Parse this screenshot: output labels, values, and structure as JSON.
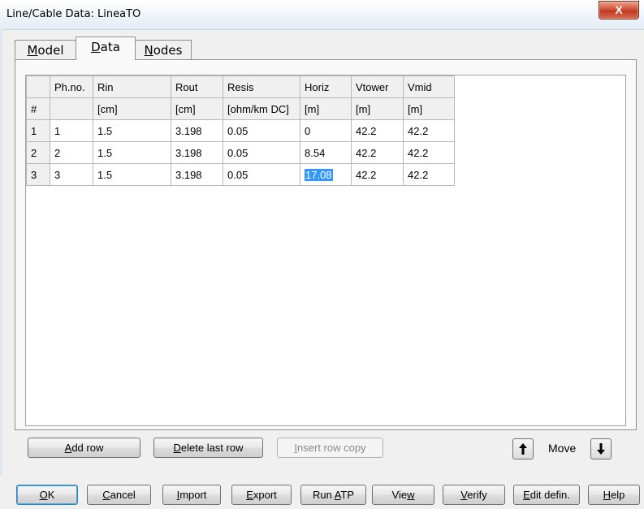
{
  "window": {
    "title": "Line/Cable Data: LineaTO",
    "close_glyph": "X"
  },
  "tabs": [
    {
      "label": "Model",
      "accel": "M",
      "rest": "odel",
      "active": false
    },
    {
      "label": "Data",
      "accel": "D",
      "rest": "ata",
      "active": true
    },
    {
      "label": "Nodes",
      "accel": "N",
      "rest": "odes",
      "active": false
    }
  ],
  "grid": {
    "header1": [
      "",
      "Ph.no.",
      "Rin",
      "Rout",
      "Resis",
      "Horiz",
      "Vtower",
      "Vmid"
    ],
    "header2": [
      "#",
      "",
      "[cm]",
      "[cm]",
      "[ohm/km DC]",
      "[m]",
      "[m]",
      "[m]"
    ],
    "rows": [
      [
        "1",
        "1",
        "1.5",
        "3.198",
        "0.05",
        "0",
        "42.2",
        "42.2"
      ],
      [
        "2",
        "2",
        "1.5",
        "3.198",
        "0.05",
        "8.54",
        "42.2",
        "42.2"
      ],
      [
        "3",
        "3",
        "1.5",
        "3.198",
        "0.05",
        "17.08",
        "42.2",
        "42.2"
      ]
    ],
    "selected_cell": {
      "row": 3,
      "column": "Horiz",
      "value": "17.08"
    }
  },
  "row_buttons": {
    "add": {
      "accel": "A",
      "rest": "dd row"
    },
    "delete": {
      "accel": "D",
      "rest": "elete last row"
    },
    "insert": {
      "accel": "I",
      "rest": "nsert row copy",
      "enabled": false
    }
  },
  "move": {
    "label": "Move",
    "up_icon": "arrow-up-icon",
    "down_icon": "arrow-down-icon"
  },
  "bottom_buttons": {
    "ok": {
      "accel": "O",
      "rest": "K"
    },
    "cancel": {
      "accel": "C",
      "rest": "ancel"
    },
    "import": {
      "accel": "I",
      "rest": "mport"
    },
    "export": {
      "accel": "E",
      "rest": "xport"
    },
    "run_atp": {
      "pre": "Run ",
      "accel": "A",
      "rest": "TP"
    },
    "view": {
      "pre": "Vie",
      "accel": "w",
      "rest": ""
    },
    "verify": {
      "accel": "V",
      "rest": "erify"
    },
    "edit_defin": {
      "accel": "E",
      "rest": "dit defin."
    },
    "help": {
      "accel": "H",
      "rest": "elp"
    }
  },
  "colors": {
    "selection": "#3399ff",
    "close_button": "#c13a21"
  }
}
